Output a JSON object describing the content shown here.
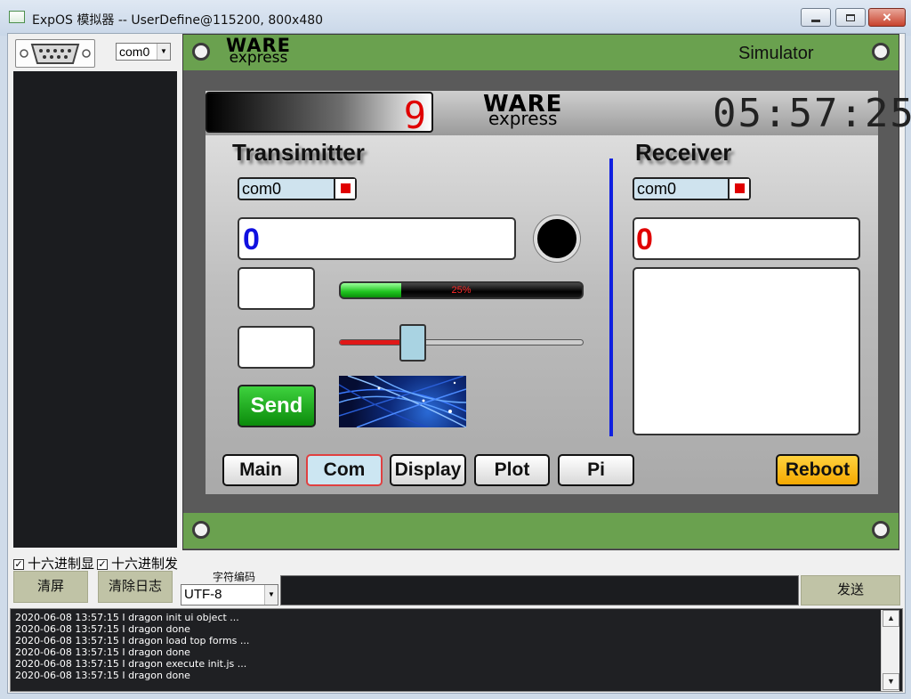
{
  "window": {
    "title": "ExpOS 模拟器 -- UserDefine@115200, 800x480",
    "minimize": "minimize",
    "maximize": "maximize",
    "close": "✕"
  },
  "left": {
    "port_select": "com0",
    "hex_display_label": "十六进制显",
    "hex_send_label": "十六进制发",
    "clear_screen_label": "清屏",
    "clear_log_label": "清除日志",
    "encoding_label": "字符编码",
    "encoding_value": "UTF-8",
    "send_label": "发送"
  },
  "simulator": {
    "label": "Simulator",
    "logo_top": "WARE",
    "logo_bottom": "express",
    "counter": "9",
    "clock": "05:57:25",
    "transmitter": {
      "heading": "Transimitter",
      "port": "com0",
      "value": "0",
      "progress_percent": 25,
      "progress_text": "25%",
      "slider_value": 30,
      "send_label": "Send"
    },
    "receiver": {
      "heading": "Receiver",
      "port": "com0",
      "value": "0"
    },
    "tabs": [
      "Main",
      "Com",
      "Display",
      "Plot",
      "Pi"
    ],
    "active_tab": "Com",
    "reboot_label": "Reboot"
  },
  "log": {
    "lines": [
      "2020-06-08 13:57:15 I dragon init ui object ...",
      "2020-06-08 13:57:15 I dragon done",
      "2020-06-08 13:57:15 I dragon load top forms ...",
      "2020-06-08 13:57:15 I dragon done",
      "2020-06-08 13:57:15 I dragon execute init.js ...",
      "2020-06-08 13:57:15 I dragon done"
    ]
  },
  "colors": {
    "transmit_value": "#1010e0",
    "receive_value": "#e00000",
    "board_green": "#6aa14f"
  }
}
